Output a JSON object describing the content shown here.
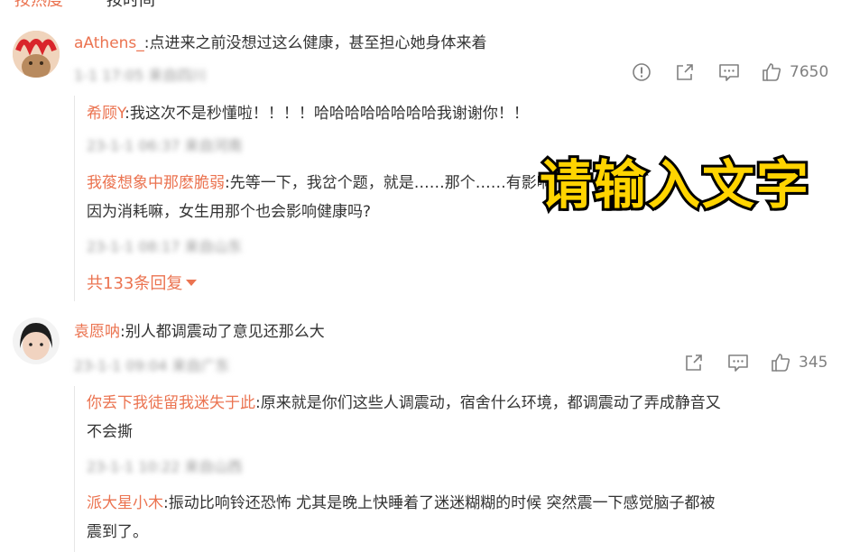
{
  "tabs": {
    "hot": "按热度",
    "time": "按时间"
  },
  "comment1": {
    "user": "aAthens_",
    "text": ":点进来之前没想过这么健康，甚至担心她身体来着",
    "meta": "1-1 17:05 来自四川",
    "likes": "7650",
    "replies": [
      {
        "user": "希顾Y",
        "text": ":我这次不是秒懂啦！！！！哈哈哈哈哈哈哈哈我谢谢你！！",
        "meta": "23-1-1 06:37 来自河南"
      },
      {
        "user": "我葰想象中那麽脆弱",
        "text": ":先等一下，我岔个题，就是……那个……有影响健康吗",
        "text2": "因为消耗嘛，女生用那个也会影响健康吗?",
        "meta": "23-1-1 08:17 来自山东"
      }
    ],
    "more": "共133条回复"
  },
  "comment2": {
    "user": "袁愿呐",
    "text": ":别人都调震动了意见还那么大",
    "meta": "23-1-1 09:04 来自广东",
    "likes": "345",
    "replies": [
      {
        "user": "你丢下我徒留我迷失于此",
        "text": ":原来就是你们这些人调震动，宿舍什么环境，都调震动了弄成静音又",
        "text2": "不会撕",
        "meta": "23-1-1 10:22 来自山西"
      },
      {
        "user": "派大星小木",
        "text": ":振动比响铃还恐怖 尤其是晚上快睡着了迷迷糊糊的时候 突然震一下感觉脑子都被",
        "text2": "震到了。"
      }
    ]
  },
  "overlay_text": "请输入文字",
  "colors": {
    "accent": "#eb7350",
    "text": "#333333",
    "meta": "#999999",
    "icon": "#808080"
  }
}
